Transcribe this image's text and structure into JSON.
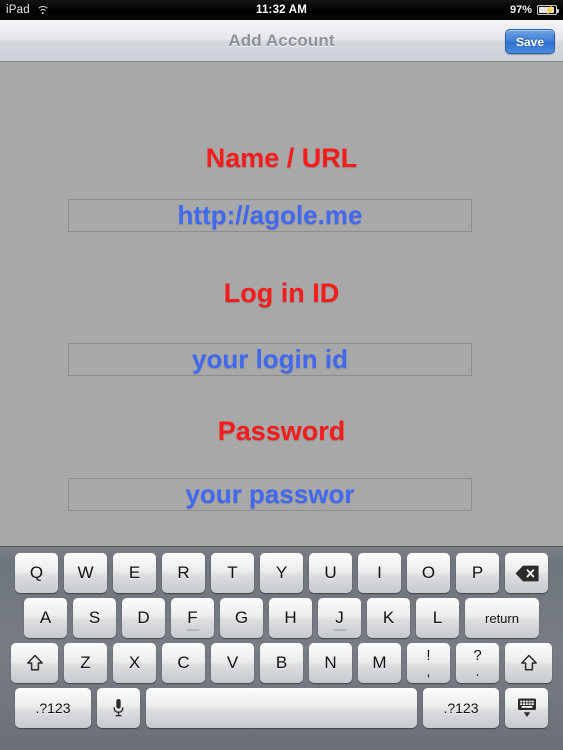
{
  "status_bar": {
    "device": "iPad",
    "wifi_icon": "wifi-icon",
    "time": "11:32 AM",
    "battery_percent": "97%",
    "battery_icon": "battery-charging-icon"
  },
  "nav_bar": {
    "title": "Add Account",
    "save_label": "Save"
  },
  "form": {
    "fields": [
      {
        "label": "Name / URL",
        "value": "http://agole.me",
        "name": "name-url"
      },
      {
        "label": "Log in ID",
        "value": "your login id",
        "name": "login-id"
      },
      {
        "label": "Password",
        "value": "your passwor",
        "name": "password"
      }
    ]
  },
  "colors": {
    "label_red": "#f71b1b",
    "value_blue": "#4169f0",
    "page_bg": "#a8a8a8",
    "save_blue": "#3f7fd6",
    "keyboard_bg": "#787d85"
  },
  "keyboard": {
    "row1": [
      "Q",
      "W",
      "E",
      "R",
      "T",
      "Y",
      "U",
      "I",
      "O",
      "P"
    ],
    "row1_backspace": "backspace-icon",
    "row2": [
      "A",
      "S",
      "D",
      "F",
      "G",
      "H",
      "J",
      "K",
      "L"
    ],
    "row2_return": "return",
    "row3_shift_left": "shift-icon",
    "row3": [
      "Z",
      "X",
      "C",
      "V",
      "B",
      "N",
      "M"
    ],
    "row3_punct1_top": "!",
    "row3_punct1_bottom": ",",
    "row3_punct2_top": "?",
    "row3_punct2_bottom": ".",
    "row3_shift_right": "shift-icon",
    "row4_numbers_left": ".?123",
    "row4_mic": "microphone-icon",
    "row4_space": "",
    "row4_numbers_right": ".?123",
    "row4_dismiss": "keyboard-dismiss-icon"
  }
}
